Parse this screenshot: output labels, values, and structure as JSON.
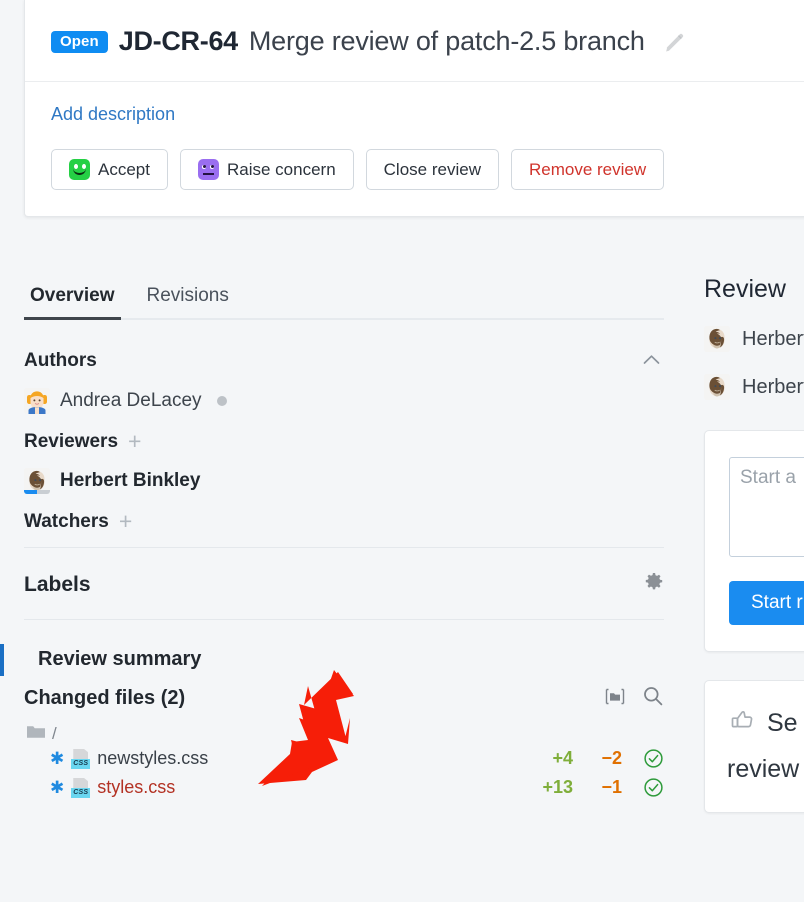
{
  "header": {
    "status_badge": "Open",
    "issue_key": "JD-CR-64",
    "summary": "Merge review of patch-2.5 branch",
    "edit_icon": "pencil-icon"
  },
  "description": {
    "add_link": "Add description"
  },
  "actions": [
    {
      "label": "Accept",
      "icon": "green-smiley-face-icon",
      "style": "default"
    },
    {
      "label": "Raise concern",
      "icon": "purple-frown-face-icon",
      "style": "default"
    },
    {
      "label": "Close review",
      "icon": "",
      "style": "default"
    },
    {
      "label": "Remove review",
      "icon": "",
      "style": "danger"
    }
  ],
  "tabs": [
    {
      "label": "Overview",
      "active": true
    },
    {
      "label": "Revisions",
      "active": false
    }
  ],
  "authors": {
    "heading": "Authors",
    "collapse_icon": "chevron-up-icon",
    "people": [
      {
        "name": "Andrea DeLacey",
        "avatar": "blonde-pigtails-avatar",
        "status": "offline"
      }
    ]
  },
  "reviewers": {
    "heading": "Reviewers",
    "add_icon": "plus-icon",
    "people": [
      {
        "name": "Herbert Binkley",
        "avatar": "bearded-man-avatar",
        "progress": 50
      }
    ]
  },
  "watchers": {
    "heading": "Watchers",
    "add_icon": "plus-icon"
  },
  "labels": {
    "heading": "Labels",
    "settings_icon": "gear-icon"
  },
  "review_summary": {
    "heading": "Review summary",
    "changed_files_heading": "Changed files (2)",
    "tree_icon": "folder-tree-icon",
    "search_icon": "search-icon",
    "root_folder": "/",
    "files": [
      {
        "name": "newstyles.css",
        "type": "css",
        "state": "added",
        "added": "+4",
        "removed": "−2",
        "reviewed": true
      },
      {
        "name": "styles.css",
        "type": "css",
        "state": "modified",
        "added": "+13",
        "removed": "−1",
        "reviewed": true
      }
    ]
  },
  "right_panel": {
    "title": "Review",
    "participants": [
      {
        "name": "Herbert",
        "avatar": "bearded-man-avatar"
      },
      {
        "name": "Herbert",
        "avatar": "bearded-man-avatar"
      }
    ],
    "comment_placeholder": "Start a",
    "start_button": "Start r",
    "promo": {
      "icon": "thumbs-up-icon",
      "line1": "Se",
      "line2": "review"
    }
  },
  "annotation": {
    "arrow_color": "#f61e08"
  }
}
